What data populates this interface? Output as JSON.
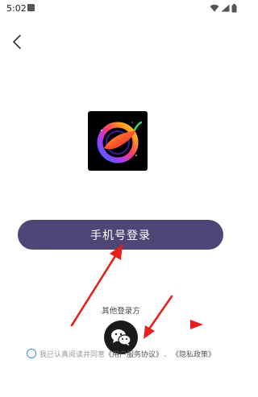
{
  "status_bar": {
    "time": "5:02",
    "icons": [
      "wifi-icon",
      "cellular-signal-icon",
      "battery-icon"
    ]
  },
  "navigation": {
    "back_icon": "chevron-left-icon"
  },
  "app_logo": {
    "icon": "chili-pepper-swirl-logo"
  },
  "login": {
    "phone_button_label": "手机号登录",
    "other_methods_label": "其他登录方",
    "wechat_icon": "wechat-icon"
  },
  "agreement": {
    "prefix": "我已认真阅读并同意",
    "user_agreement": "《用户服务协议》",
    "separator": "、",
    "privacy_policy": "《隐私政策》"
  },
  "colors": {
    "primary_button": "#4f4577",
    "annotation_arrow": "#e8201c",
    "radio_border": "#3a8dde"
  }
}
